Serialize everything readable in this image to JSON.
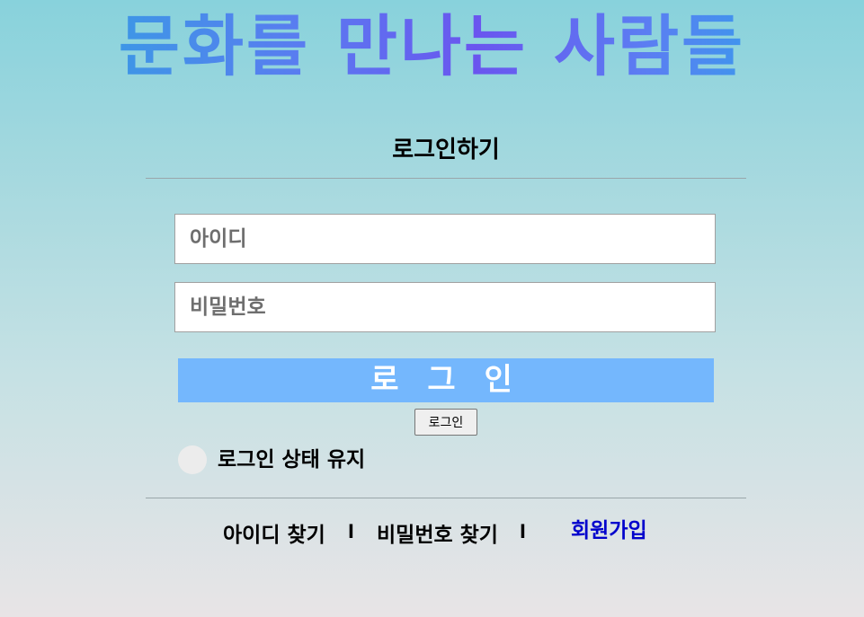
{
  "header": {
    "title": "문화를 만나는 사람들"
  },
  "login_form": {
    "heading": "로그인하기",
    "id_field": {
      "placeholder": "아이디",
      "value": ""
    },
    "password_field": {
      "placeholder": "비밀번호",
      "value": ""
    },
    "login_banner_label": "로 그 인",
    "submit_button_label": "로그인",
    "keep_login": {
      "label": "로그인 상태 유지",
      "checked": false
    }
  },
  "footer": {
    "find_id_label": "아이디 찾기",
    "separator": "l",
    "find_password_label": "비밀번호 찾기",
    "signup_label": "회원가입"
  },
  "colors": {
    "banner": "#74b7fd",
    "signup_link": "#0000cc",
    "title_gradient": [
      "#2ba7e0",
      "#6a55ef",
      "#1fb0e8"
    ]
  }
}
